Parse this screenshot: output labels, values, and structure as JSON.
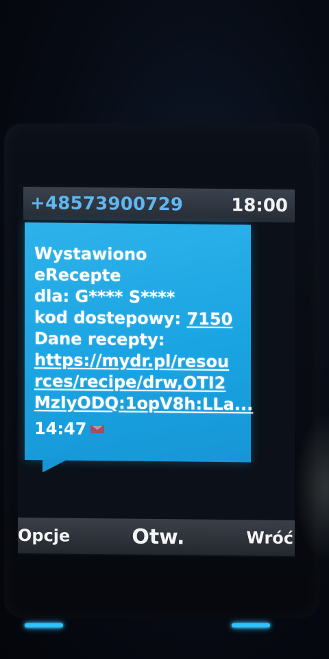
{
  "status_bar": {
    "sender": "+48573900729",
    "clock": "18:00"
  },
  "message": {
    "lines": [
      "Wystawiono",
      "eRecepte",
      "dla: G**** S****",
      "kod dostepowy: ",
      "Dane recepty:"
    ],
    "access_code": "7150",
    "link_lines": [
      "https://mydr.pl/resou",
      "rces/recipe/drw,OTI2",
      "MzIyODQ:1opV8h:LLa..."
    ],
    "time": "14:47"
  },
  "softkeys": {
    "left": "Opcje",
    "center": "Otw.",
    "right": "Wróć"
  },
  "colors": {
    "bubble": "#1aa4e2",
    "sender": "#5fb6f0",
    "key_light": "#2ec3ff"
  }
}
